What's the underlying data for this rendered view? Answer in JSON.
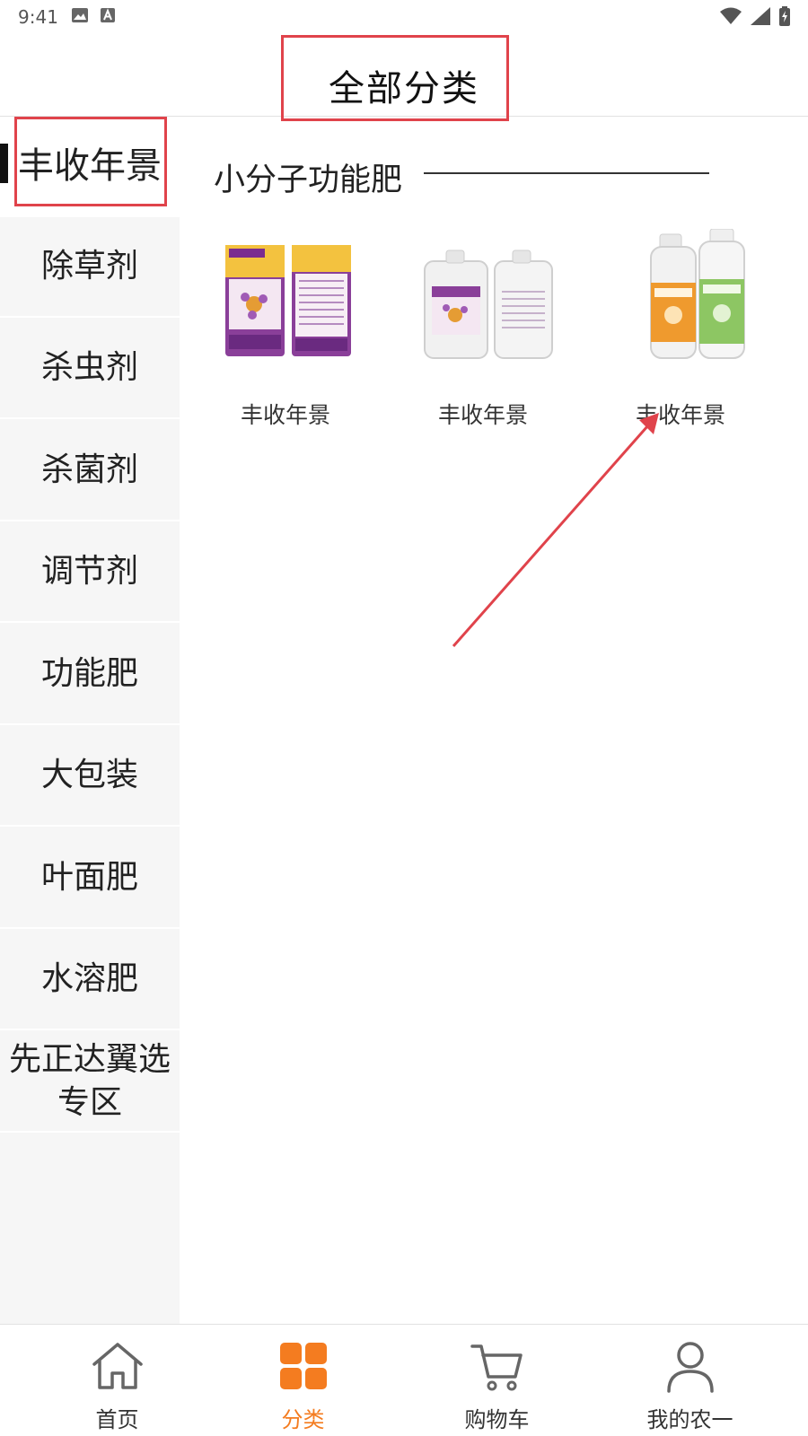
{
  "status": {
    "time": "9:41"
  },
  "header": {
    "title": "全部分类"
  },
  "sidebar": {
    "items": [
      {
        "label": "丰收年景",
        "active": true
      },
      {
        "label": "除草剂"
      },
      {
        "label": "杀虫剂"
      },
      {
        "label": "杀菌剂"
      },
      {
        "label": "调节剂"
      },
      {
        "label": "功能肥"
      },
      {
        "label": "大包装"
      },
      {
        "label": "叶面肥"
      },
      {
        "label": "水溶肥"
      },
      {
        "label": "先正达翼选\n专区"
      }
    ]
  },
  "content": {
    "section_title": "小分子功能肥",
    "products": [
      {
        "name": "丰收年景",
        "image": "fertilizer-bags"
      },
      {
        "name": "丰收年景",
        "image": "fertilizer-jugs"
      },
      {
        "name": "丰收年景",
        "image": "fertilizer-bottles"
      }
    ]
  },
  "tabbar": {
    "tabs": [
      {
        "label": "首页",
        "icon": "home-icon"
      },
      {
        "label": "分类",
        "icon": "category-grid-icon",
        "active": true
      },
      {
        "label": "购物车",
        "icon": "cart-icon"
      },
      {
        "label": "我的农一",
        "icon": "user-icon"
      }
    ]
  },
  "colors": {
    "accent": "#f47c20",
    "annotation": "#e0434b",
    "sidebar_bg": "#f6f6f6"
  }
}
